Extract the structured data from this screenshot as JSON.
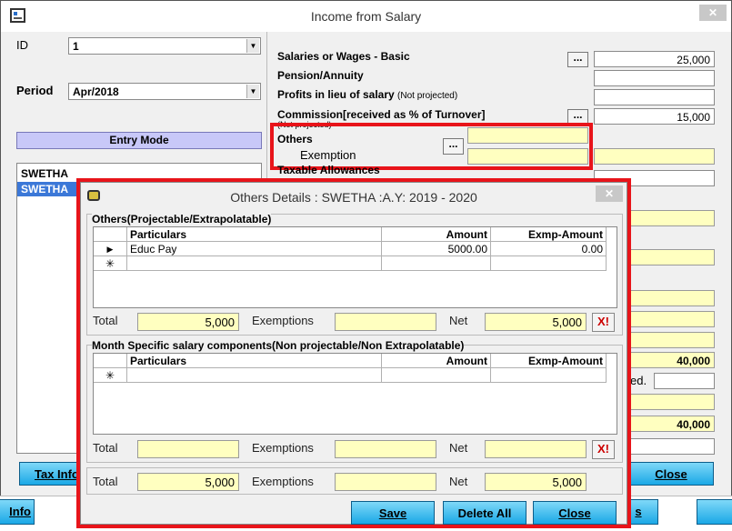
{
  "main": {
    "title": "Income from Salary",
    "id_label": "ID",
    "id_value": "1",
    "period_label": "Period",
    "period_value": "Apr/2018",
    "entry_mode_label": "Entry Mode",
    "employees": [
      "SWETHA",
      "SWETHA"
    ],
    "rows": {
      "salaries_label": "Salaries or Wages - Basic",
      "salaries_value": "25,000",
      "pension_label": "Pension/Annuity",
      "profits_label": "Profits in lieu of salary",
      "profits_note": "(Not projected)",
      "commission_label": "Commission[received as % of Turnover]",
      "commission_note": "(Not projected)",
      "commission_value": "15,000",
      "others_label": "Others",
      "exemption_label": "Exemption",
      "taxable_label": "Taxable Allowances",
      "dots": "..."
    },
    "right_values": {
      "v1": "40,000",
      "v2": "40,000",
      "partial_label": "ed."
    },
    "buttons": {
      "tax_info": "Tax Info",
      "close": "Close",
      "info": "Info",
      "s": "s"
    }
  },
  "dialog": {
    "title": "Others Details : SWETHA :A.Y: 2019 - 2020",
    "section1_title": "Others(Projectable/Extrapolatable)",
    "section2_title": "Month Specific salary components(Non projectable/Non Extrapolatable)",
    "columns": [
      "Particulars",
      "Amount",
      "Exmp-Amount"
    ],
    "grid1_rows": [
      {
        "particulars": "Educ Pay",
        "amount": "5000.00",
        "exmp": "0.00"
      }
    ],
    "row_marker": "▶",
    "new_row_marker": "✳",
    "total_label": "Total",
    "exemptions_label": "Exemptions",
    "net_label": "Net",
    "s1": {
      "total": "5,000",
      "exemptions": "",
      "net": "5,000"
    },
    "s2": {
      "total": "",
      "exemptions": "",
      "net": ""
    },
    "grand": {
      "total": "5,000",
      "exemptions": "",
      "net": "5,000"
    },
    "clear_label": "X!",
    "buttons": {
      "save": "Save",
      "delete_all": "Delete All",
      "close": "Close"
    }
  },
  "colors": {
    "highlight": "#e8141a",
    "field_yellow": "#ffffc0",
    "entry_mode": "#c8c8f8",
    "button": "#1aa8e6"
  }
}
